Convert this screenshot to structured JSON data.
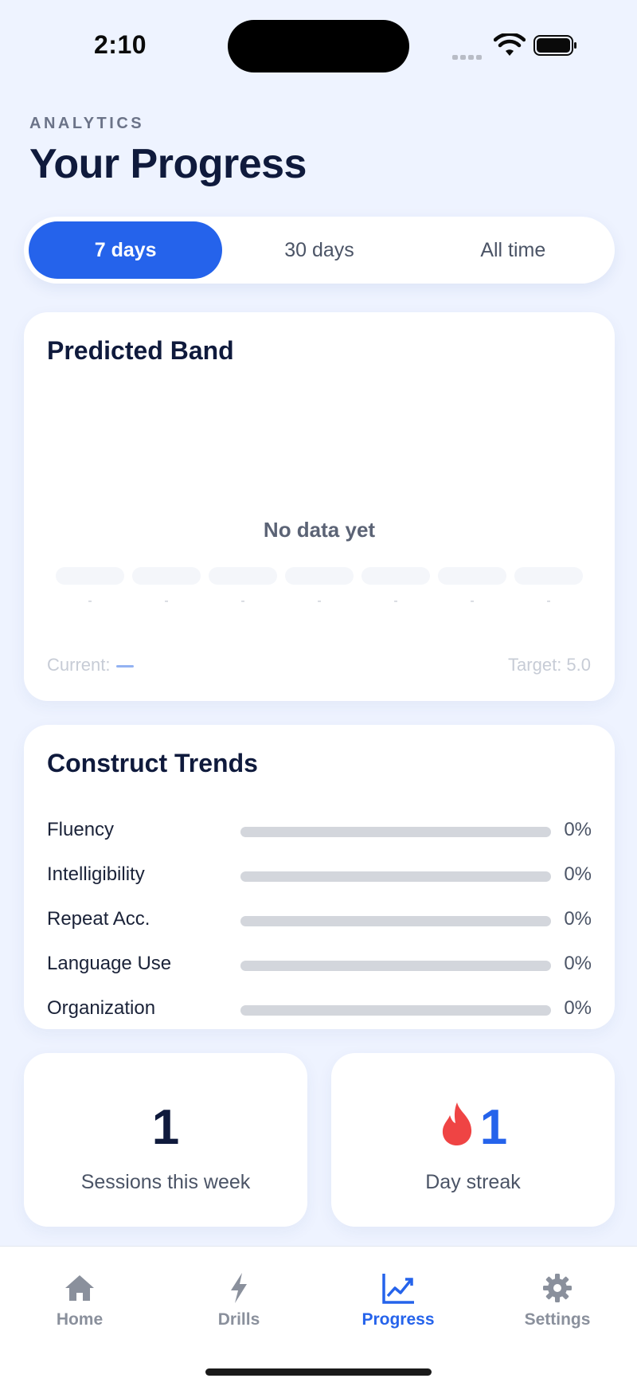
{
  "status_bar": {
    "time": "2:10"
  },
  "header": {
    "eyebrow": "ANALYTICS",
    "title": "Your Progress"
  },
  "range_selector": {
    "options": [
      "7 days",
      "30 days",
      "All time"
    ],
    "selected": "7 days"
  },
  "predicted_band": {
    "title": "Predicted Band",
    "empty_message": "No data yet",
    "x_ticks": [
      "-",
      "-",
      "-",
      "-",
      "-",
      "-",
      "-"
    ],
    "current_label": "Current:",
    "target_label": "Target: 5.0"
  },
  "construct_trends": {
    "title": "Construct Trends",
    "items": [
      {
        "label": "Fluency",
        "value_text": "0%",
        "value": 0
      },
      {
        "label": "Intelligibility",
        "value_text": "0%",
        "value": 0
      },
      {
        "label": "Repeat Acc.",
        "value_text": "0%",
        "value": 0
      },
      {
        "label": "Language Use",
        "value_text": "0%",
        "value": 0
      },
      {
        "label": "Organization",
        "value_text": "0%",
        "value": 0
      }
    ]
  },
  "stats": {
    "sessions": {
      "value": "1",
      "label": "Sessions this week"
    },
    "streak": {
      "value": "1",
      "label": "Day streak",
      "icon": "flame-icon"
    }
  },
  "tab_bar": {
    "tabs": [
      {
        "label": "Home",
        "icon": "home-icon"
      },
      {
        "label": "Drills",
        "icon": "bolt-icon"
      },
      {
        "label": "Progress",
        "icon": "chart-icon"
      },
      {
        "label": "Settings",
        "icon": "gear-icon"
      }
    ],
    "active": "Progress"
  },
  "colors": {
    "accent": "#2563eb",
    "background": "#eef3ff",
    "title": "#0f1a3c",
    "flame": "#ef4444"
  }
}
